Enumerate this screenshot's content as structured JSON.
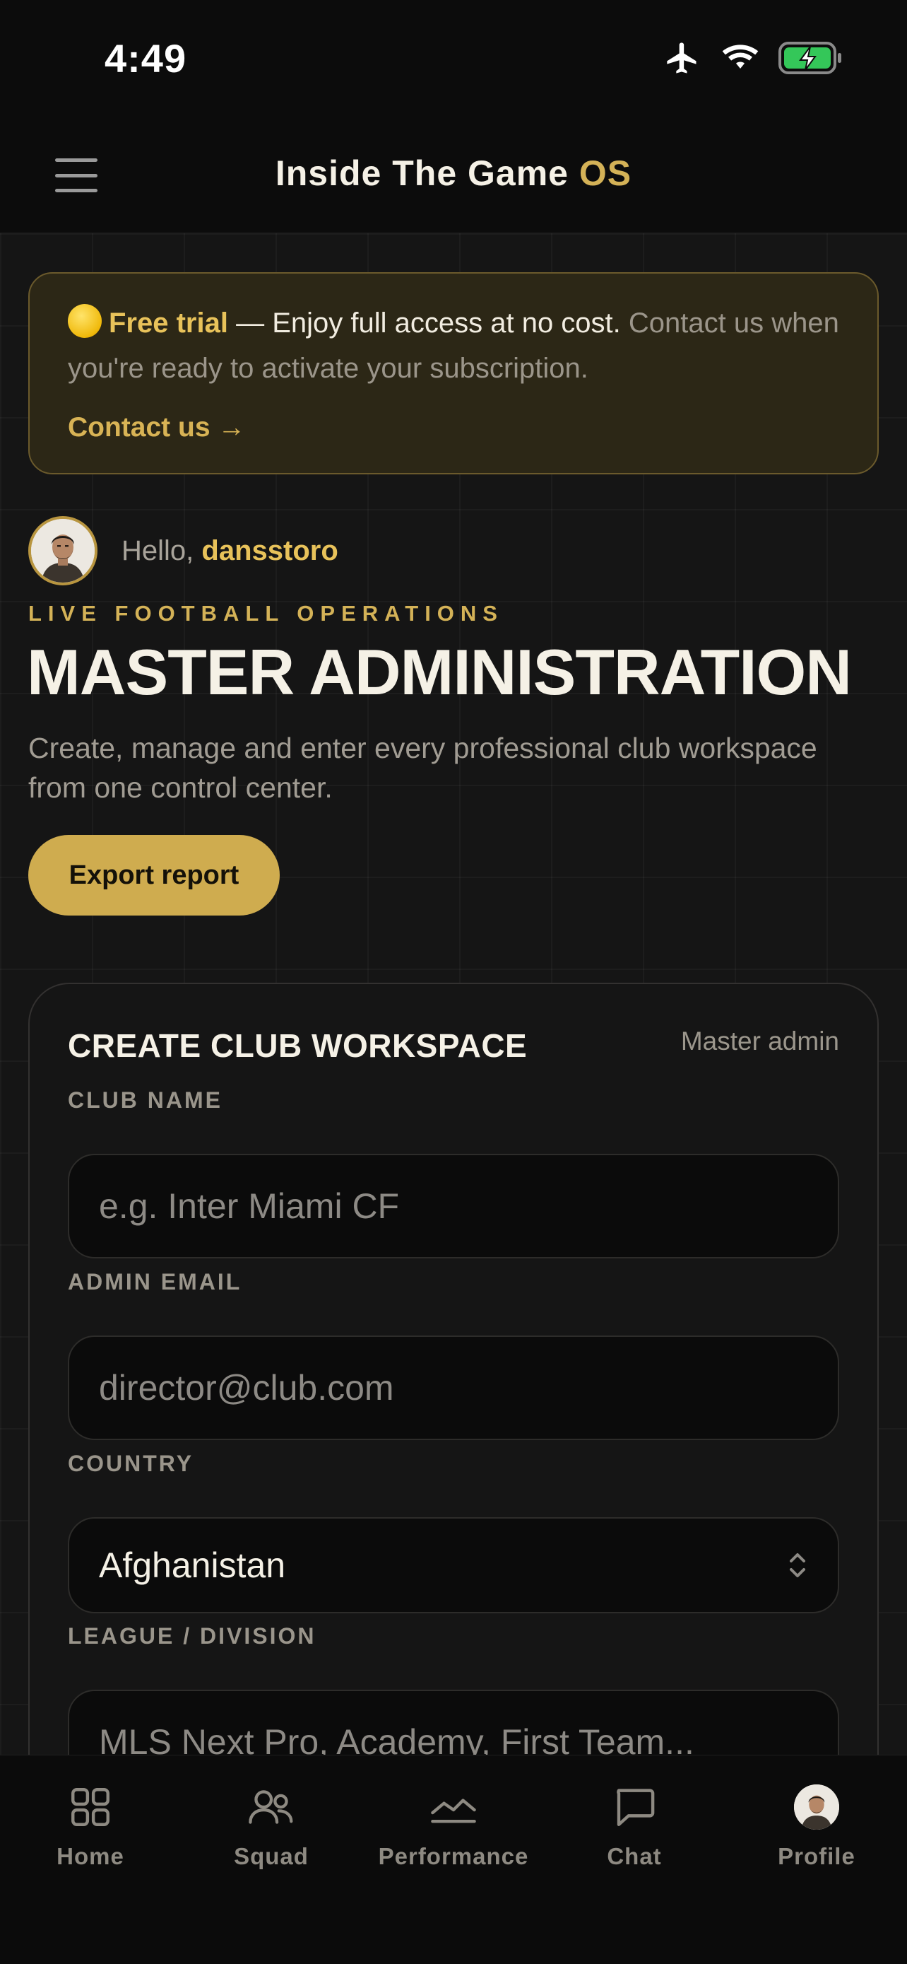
{
  "status_bar": {
    "time": "4:49"
  },
  "header": {
    "title": "Inside The Game",
    "title_accent": "OS"
  },
  "trial_banner": {
    "strong": "Free trial",
    "text": " — Enjoy full access at no cost. ",
    "muted": "Contact us when you're ready to activate your subscription.",
    "link": "Contact us →"
  },
  "greeting": {
    "prefix": "Hello, ",
    "username": "dansstoro"
  },
  "hero": {
    "eyebrow": "LIVE FOOTBALL OPERATIONS",
    "title": "MASTER ADMINISTRATION",
    "subtitle": "Create, manage and enter every professional club workspace from one control center.",
    "export_button": "Export report"
  },
  "form": {
    "title": "CREATE CLUB WORKSPACE",
    "tag": "Master admin",
    "club_name": {
      "label": "CLUB NAME",
      "placeholder": "e.g. Inter Miami CF",
      "value": ""
    },
    "admin_email": {
      "label": "ADMIN EMAIL",
      "placeholder": "director@club.com",
      "value": ""
    },
    "country": {
      "label": "COUNTRY",
      "value": "Afghanistan"
    },
    "league": {
      "label": "LEAGUE / DIVISION",
      "placeholder": "MLS Next Pro, Academy, First Team...",
      "value": ""
    }
  },
  "tab_bar": {
    "home": "Home",
    "squad": "Squad",
    "performance": "Performance",
    "chat": "Chat",
    "profile": "Profile"
  },
  "colors": {
    "accent": "#d4b257",
    "background": "#151515",
    "banner": "#2c2716"
  }
}
